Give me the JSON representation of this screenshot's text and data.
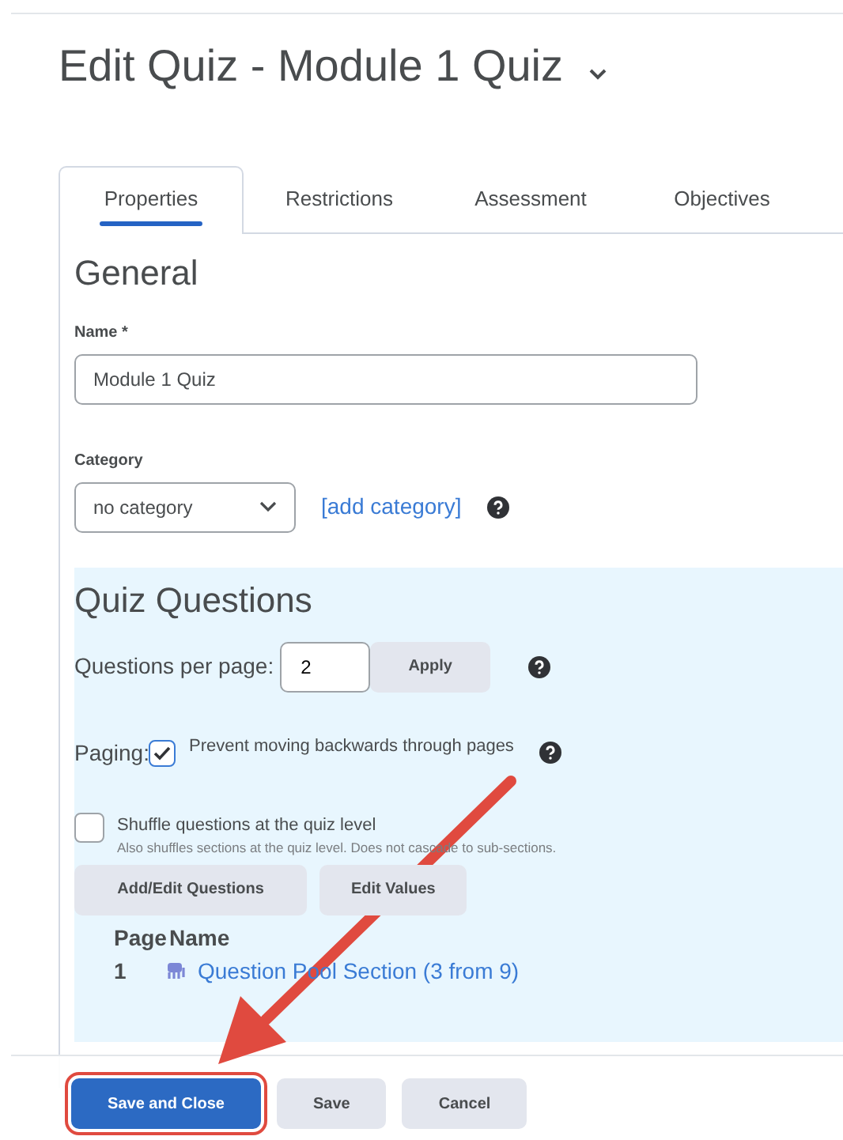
{
  "page_title": "Edit Quiz - Module 1 Quiz",
  "tabs": [
    {
      "label": "Properties",
      "selected": true
    },
    {
      "label": "Restrictions",
      "selected": false
    },
    {
      "label": "Assessment",
      "selected": false
    },
    {
      "label": "Objectives",
      "selected": false
    }
  ],
  "general": {
    "heading": "General",
    "name_label": "Name *",
    "name_value": "Module 1 Quiz",
    "category_label": "Category",
    "category_value": "no category",
    "add_category": "[add category]"
  },
  "quiz_questions": {
    "heading": "Quiz Questions",
    "per_page_label": "Questions per page:",
    "per_page_value": "2",
    "apply": "Apply",
    "paging_label": "Paging:",
    "paging_option": {
      "label": "Prevent moving backwards through pages",
      "checked": true
    },
    "shuffle": {
      "label": "Shuffle questions at the quiz level",
      "hint": "Also shuffles sections at the quiz level. Does not cascade to sub-sections.",
      "checked": false
    },
    "buttons": [
      "Add/Edit Questions",
      "Edit Values"
    ],
    "table": {
      "columns": [
        "Page",
        "Name"
      ],
      "rows": [
        {
          "page": "1",
          "name": "Question Pool Section (3 from 9)"
        }
      ]
    }
  },
  "footer": {
    "buttons": [
      {
        "label": "Save and Close",
        "kind": "primary",
        "highlighted": true
      },
      {
        "label": "Save",
        "kind": "secondary",
        "highlighted": false
      },
      {
        "label": "Cancel",
        "kind": "secondary",
        "highlighted": false
      }
    ]
  },
  "annotation": {
    "kind": "arrow"
  }
}
